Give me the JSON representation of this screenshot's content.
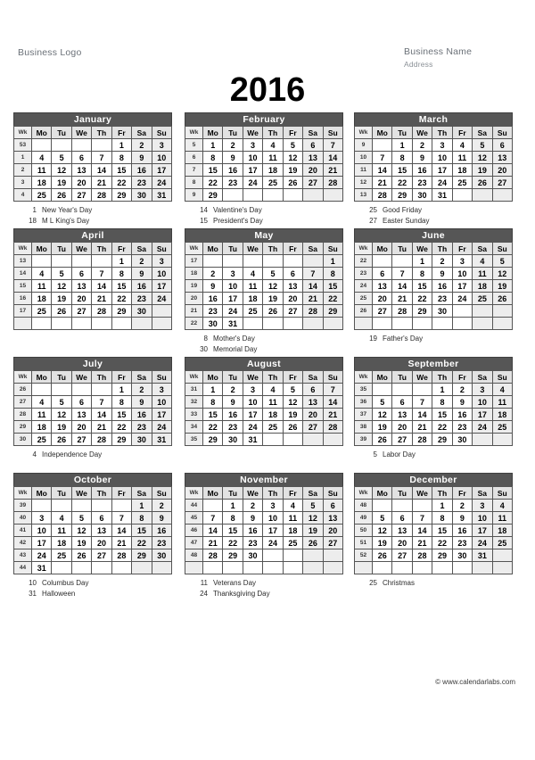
{
  "header": {
    "business_logo": "Business Logo",
    "business_name": "Business Name",
    "address": "Address"
  },
  "year": "2016",
  "footer": "© www.calendarlabs.com",
  "weekday_headers": [
    "Wk",
    "Mo",
    "Tu",
    "We",
    "Th",
    "Fr",
    "Sa",
    "Su"
  ],
  "colors": {
    "month_header_bg": "#565656",
    "month_header_text": "#ffffff",
    "weekday_header_bg": "#e2e2e2",
    "week_number_bg": "#ededed",
    "weekend_bg": "#ededed",
    "grid_border": "#555555",
    "label_text": "#6b7178"
  },
  "months": [
    {
      "name": "January",
      "weeks": [
        {
          "wk": "53",
          "days": [
            "",
            "",
            "",
            "",
            "1",
            "2",
            "3"
          ]
        },
        {
          "wk": "1",
          "days": [
            "4",
            "5",
            "6",
            "7",
            "8",
            "9",
            "10"
          ]
        },
        {
          "wk": "2",
          "days": [
            "11",
            "12",
            "13",
            "14",
            "15",
            "16",
            "17"
          ]
        },
        {
          "wk": "3",
          "days": [
            "18",
            "19",
            "20",
            "21",
            "22",
            "23",
            "24"
          ]
        },
        {
          "wk": "4",
          "days": [
            "25",
            "26",
            "27",
            "28",
            "29",
            "30",
            "31"
          ]
        }
      ],
      "holiday_days": [
        1,
        18
      ],
      "holidays": [
        {
          "day": "1",
          "name": "New Year's Day"
        },
        {
          "day": "18",
          "name": "M L King's Day"
        }
      ]
    },
    {
      "name": "February",
      "weeks": [
        {
          "wk": "5",
          "days": [
            "1",
            "2",
            "3",
            "4",
            "5",
            "6",
            "7"
          ]
        },
        {
          "wk": "6",
          "days": [
            "8",
            "9",
            "10",
            "11",
            "12",
            "13",
            "14"
          ]
        },
        {
          "wk": "7",
          "days": [
            "15",
            "16",
            "17",
            "18",
            "19",
            "20",
            "21"
          ]
        },
        {
          "wk": "8",
          "days": [
            "22",
            "23",
            "24",
            "25",
            "26",
            "27",
            "28"
          ]
        },
        {
          "wk": "9",
          "days": [
            "29",
            "",
            "",
            "",
            "",
            "",
            ""
          ]
        }
      ],
      "holiday_days": [
        14,
        15
      ],
      "holidays": [
        {
          "day": "14",
          "name": "Valentine's Day"
        },
        {
          "day": "15",
          "name": "President's Day"
        }
      ]
    },
    {
      "name": "March",
      "weeks": [
        {
          "wk": "9",
          "days": [
            "",
            "1",
            "2",
            "3",
            "4",
            "5",
            "6"
          ]
        },
        {
          "wk": "10",
          "days": [
            "7",
            "8",
            "9",
            "10",
            "11",
            "12",
            "13"
          ]
        },
        {
          "wk": "11",
          "days": [
            "14",
            "15",
            "16",
            "17",
            "18",
            "19",
            "20"
          ]
        },
        {
          "wk": "12",
          "days": [
            "21",
            "22",
            "23",
            "24",
            "25",
            "26",
            "27"
          ]
        },
        {
          "wk": "13",
          "days": [
            "28",
            "29",
            "30",
            "31",
            "",
            "",
            ""
          ]
        }
      ],
      "holiday_days": [
        25,
        27
      ],
      "holidays": [
        {
          "day": "25",
          "name": "Good Friday"
        },
        {
          "day": "27",
          "name": "Easter Sunday"
        }
      ]
    },
    {
      "name": "April",
      "weeks": [
        {
          "wk": "13",
          "days": [
            "",
            "",
            "",
            "",
            "1",
            "2",
            "3"
          ]
        },
        {
          "wk": "14",
          "days": [
            "4",
            "5",
            "6",
            "7",
            "8",
            "9",
            "10"
          ]
        },
        {
          "wk": "15",
          "days": [
            "11",
            "12",
            "13",
            "14",
            "15",
            "16",
            "17"
          ]
        },
        {
          "wk": "16",
          "days": [
            "18",
            "19",
            "20",
            "21",
            "22",
            "23",
            "24"
          ]
        },
        {
          "wk": "17",
          "days": [
            "25",
            "26",
            "27",
            "28",
            "29",
            "30",
            ""
          ]
        },
        {
          "wk": "",
          "days": [
            "",
            "",
            "",
            "",
            "",
            "",
            ""
          ]
        }
      ],
      "holiday_days": [],
      "holidays": []
    },
    {
      "name": "May",
      "weeks": [
        {
          "wk": "17",
          "days": [
            "",
            "",
            "",
            "",
            "",
            "",
            "1"
          ]
        },
        {
          "wk": "18",
          "days": [
            "2",
            "3",
            "4",
            "5",
            "6",
            "7",
            "8"
          ]
        },
        {
          "wk": "19",
          "days": [
            "9",
            "10",
            "11",
            "12",
            "13",
            "14",
            "15"
          ]
        },
        {
          "wk": "20",
          "days": [
            "16",
            "17",
            "18",
            "19",
            "20",
            "21",
            "22"
          ]
        },
        {
          "wk": "21",
          "days": [
            "23",
            "24",
            "25",
            "26",
            "27",
            "28",
            "29"
          ]
        },
        {
          "wk": "22",
          "days": [
            "30",
            "31",
            "",
            "",
            "",
            "",
            ""
          ]
        }
      ],
      "holiday_days": [
        8,
        30
      ],
      "holidays": [
        {
          "day": "8",
          "name": "Mother's Day"
        },
        {
          "day": "30",
          "name": "Memorial Day"
        }
      ]
    },
    {
      "name": "June",
      "weeks": [
        {
          "wk": "22",
          "days": [
            "",
            "",
            "1",
            "2",
            "3",
            "4",
            "5"
          ]
        },
        {
          "wk": "23",
          "days": [
            "6",
            "7",
            "8",
            "9",
            "10",
            "11",
            "12"
          ]
        },
        {
          "wk": "24",
          "days": [
            "13",
            "14",
            "15",
            "16",
            "17",
            "18",
            "19"
          ]
        },
        {
          "wk": "25",
          "days": [
            "20",
            "21",
            "22",
            "23",
            "24",
            "25",
            "26"
          ]
        },
        {
          "wk": "26",
          "days": [
            "27",
            "28",
            "29",
            "30",
            "",
            "",
            ""
          ]
        },
        {
          "wk": "",
          "days": [
            "",
            "",
            "",
            "",
            "",
            "",
            ""
          ]
        }
      ],
      "holiday_days": [
        19
      ],
      "holidays": [
        {
          "day": "19",
          "name": "Father's Day"
        }
      ]
    },
    {
      "name": "July",
      "weeks": [
        {
          "wk": "26",
          "days": [
            "",
            "",
            "",
            "",
            "1",
            "2",
            "3"
          ]
        },
        {
          "wk": "27",
          "days": [
            "4",
            "5",
            "6",
            "7",
            "8",
            "9",
            "10"
          ]
        },
        {
          "wk": "28",
          "days": [
            "11",
            "12",
            "13",
            "14",
            "15",
            "16",
            "17"
          ]
        },
        {
          "wk": "29",
          "days": [
            "18",
            "19",
            "20",
            "21",
            "22",
            "23",
            "24"
          ]
        },
        {
          "wk": "30",
          "days": [
            "25",
            "26",
            "27",
            "28",
            "29",
            "30",
            "31"
          ]
        }
      ],
      "holiday_days": [
        4
      ],
      "holidays": [
        {
          "day": "4",
          "name": "Independence Day"
        }
      ]
    },
    {
      "name": "August",
      "weeks": [
        {
          "wk": "31",
          "days": [
            "1",
            "2",
            "3",
            "4",
            "5",
            "6",
            "7"
          ]
        },
        {
          "wk": "32",
          "days": [
            "8",
            "9",
            "10",
            "11",
            "12",
            "13",
            "14"
          ]
        },
        {
          "wk": "33",
          "days": [
            "15",
            "16",
            "17",
            "18",
            "19",
            "20",
            "21"
          ]
        },
        {
          "wk": "34",
          "days": [
            "22",
            "23",
            "24",
            "25",
            "26",
            "27",
            "28"
          ]
        },
        {
          "wk": "35",
          "days": [
            "29",
            "30",
            "31",
            "",
            "",
            "",
            ""
          ]
        }
      ],
      "holiday_days": [],
      "holidays": []
    },
    {
      "name": "September",
      "weeks": [
        {
          "wk": "35",
          "days": [
            "",
            "",
            "",
            "1",
            "2",
            "3",
            "4"
          ]
        },
        {
          "wk": "36",
          "days": [
            "5",
            "6",
            "7",
            "8",
            "9",
            "10",
            "11"
          ]
        },
        {
          "wk": "37",
          "days": [
            "12",
            "13",
            "14",
            "15",
            "16",
            "17",
            "18"
          ]
        },
        {
          "wk": "38",
          "days": [
            "19",
            "20",
            "21",
            "22",
            "23",
            "24",
            "25"
          ]
        },
        {
          "wk": "39",
          "days": [
            "26",
            "27",
            "28",
            "29",
            "30",
            "",
            ""
          ]
        }
      ],
      "holiday_days": [
        5
      ],
      "holidays": [
        {
          "day": "5",
          "name": "Labor Day"
        }
      ]
    },
    {
      "name": "October",
      "weeks": [
        {
          "wk": "39",
          "days": [
            "",
            "",
            "",
            "",
            "",
            "1",
            "2"
          ]
        },
        {
          "wk": "40",
          "days": [
            "3",
            "4",
            "5",
            "6",
            "7",
            "8",
            "9"
          ]
        },
        {
          "wk": "41",
          "days": [
            "10",
            "11",
            "12",
            "13",
            "14",
            "15",
            "16"
          ]
        },
        {
          "wk": "42",
          "days": [
            "17",
            "18",
            "19",
            "20",
            "21",
            "22",
            "23"
          ]
        },
        {
          "wk": "43",
          "days": [
            "24",
            "25",
            "26",
            "27",
            "28",
            "29",
            "30"
          ]
        },
        {
          "wk": "44",
          "days": [
            "31",
            "",
            "",
            "",
            "",
            "",
            ""
          ]
        }
      ],
      "holiday_days": [
        10,
        31
      ],
      "holidays": [
        {
          "day": "10",
          "name": "Columbus Day"
        },
        {
          "day": "31",
          "name": "Halloween"
        }
      ]
    },
    {
      "name": "November",
      "weeks": [
        {
          "wk": "44",
          "days": [
            "",
            "1",
            "2",
            "3",
            "4",
            "5",
            "6"
          ]
        },
        {
          "wk": "45",
          "days": [
            "7",
            "8",
            "9",
            "10",
            "11",
            "12",
            "13"
          ]
        },
        {
          "wk": "46",
          "days": [
            "14",
            "15",
            "16",
            "17",
            "18",
            "19",
            "20"
          ]
        },
        {
          "wk": "47",
          "days": [
            "21",
            "22",
            "23",
            "24",
            "25",
            "26",
            "27"
          ]
        },
        {
          "wk": "48",
          "days": [
            "28",
            "29",
            "30",
            "",
            "",
            "",
            ""
          ]
        },
        {
          "wk": "",
          "days": [
            "",
            "",
            "",
            "",
            "",
            "",
            ""
          ]
        }
      ],
      "holiday_days": [
        11,
        24
      ],
      "holidays": [
        {
          "day": "11",
          "name": "Veterans Day"
        },
        {
          "day": "24",
          "name": "Thanksgiving Day"
        }
      ]
    },
    {
      "name": "December",
      "weeks": [
        {
          "wk": "48",
          "days": [
            "",
            "",
            "",
            "1",
            "2",
            "3",
            "4"
          ]
        },
        {
          "wk": "49",
          "days": [
            "5",
            "6",
            "7",
            "8",
            "9",
            "10",
            "11"
          ]
        },
        {
          "wk": "50",
          "days": [
            "12",
            "13",
            "14",
            "15",
            "16",
            "17",
            "18"
          ]
        },
        {
          "wk": "51",
          "days": [
            "19",
            "20",
            "21",
            "22",
            "23",
            "24",
            "25"
          ]
        },
        {
          "wk": "52",
          "days": [
            "26",
            "27",
            "28",
            "29",
            "30",
            "31",
            ""
          ]
        },
        {
          "wk": "",
          "days": [
            "",
            "",
            "",
            "",
            "",
            "",
            ""
          ]
        }
      ],
      "holiday_days": [
        25
      ],
      "holidays": [
        {
          "day": "25",
          "name": "Christmas"
        }
      ]
    }
  ]
}
